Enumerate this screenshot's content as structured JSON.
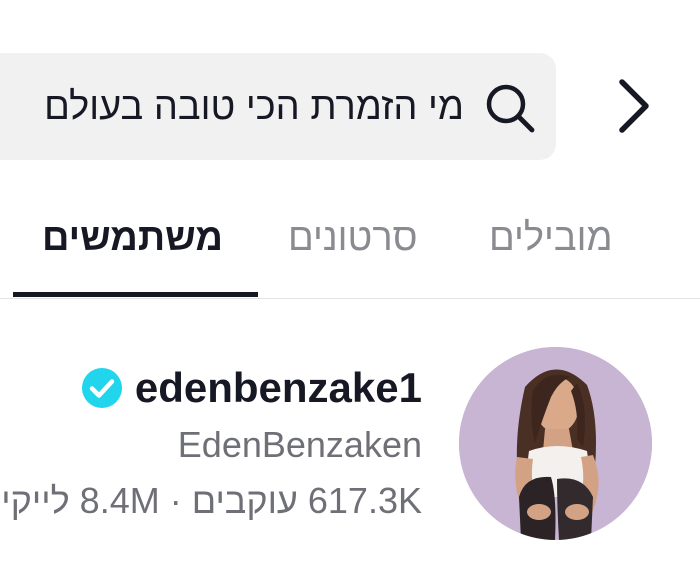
{
  "header": {
    "back_icon": "chevron-right-icon",
    "search": {
      "query": "מי הזמרת הכי טובה בעולם",
      "icon": "search-icon"
    }
  },
  "tabs": [
    {
      "label": "מובילים",
      "active": false
    },
    {
      "label": "סרטונים",
      "active": false
    },
    {
      "label": "משתמשים",
      "active": true
    }
  ],
  "results": [
    {
      "username": "edenbenzake1",
      "verified": true,
      "display_name": "EdenBenzaken",
      "followers": "617.3K",
      "followers_label": "עוקבים",
      "separator": "·",
      "likes": "8.4M",
      "likes_label": "לייקים"
    }
  ],
  "colors": {
    "verified": "#20d5ec",
    "search_bg": "#f1f1f2",
    "text_primary": "#161823",
    "text_secondary": "#6f7077"
  }
}
